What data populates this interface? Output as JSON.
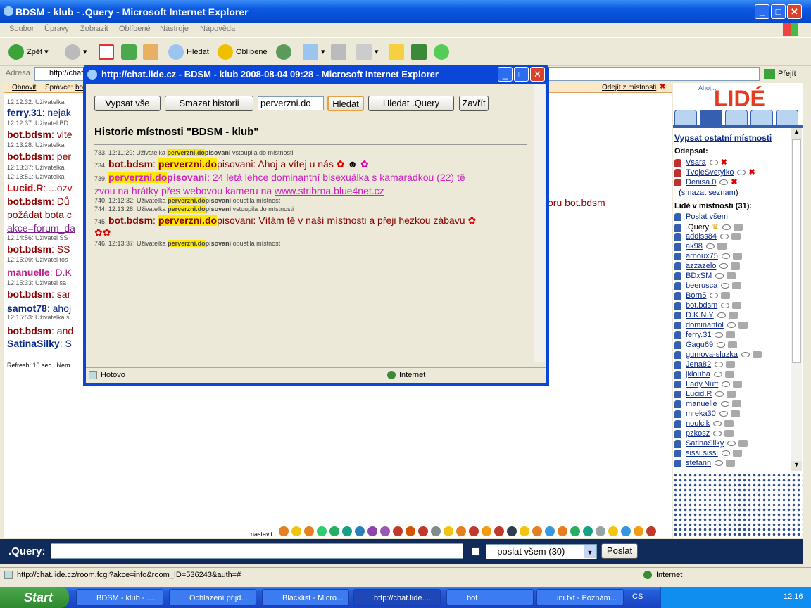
{
  "window": {
    "title": "BDSM - klub - .Query - Microsoft Internet Explorer"
  },
  "menu": [
    "Soubor",
    "Úpravy",
    "Zobrazit",
    "Oblíbené",
    "Nástroje",
    "Nápověda"
  ],
  "toolbar": {
    "back": "Zpět",
    "search": "Hledat",
    "favorites": "Oblíbené"
  },
  "address": {
    "label": "Adresa",
    "value": "http://chat",
    "go": "Přejít"
  },
  "orangebar": {
    "refresh": "Obnovit",
    "admin": "Správce:",
    "admin_name": "bo",
    "leave": "Odejít z místnosti"
  },
  "chat": [
    {
      "type": "sys",
      "text": "12:12:32: Uživatelka"
    },
    {
      "type": "msg",
      "nick": "ferry.31",
      "text": ": nejak",
      "style": "n"
    },
    {
      "type": "sys",
      "text": "12:12:37: Uživatel BD"
    },
    {
      "type": "msg",
      "nick": "bot.bdsm",
      "text": ": vite",
      "style": "b"
    },
    {
      "type": "sys",
      "text": "12:13:28: Uživatelka"
    },
    {
      "type": "msg",
      "nick": "bot.bdsm",
      "text": ": per",
      "style": "b"
    },
    {
      "type": "sys",
      "text": "12:13:37: Uživatelka"
    },
    {
      "type": "sys",
      "text": "12:13:51: Uživatelka"
    },
    {
      "type": "msg",
      "nick": "Lucid.R",
      "text": ": ...ozv",
      "style": "r"
    },
    {
      "type": "msg",
      "nick": "bot.bdsm",
      "text": ": Dů",
      "style": "b"
    },
    {
      "type": "plain",
      "text": "požádat bota c"
    },
    {
      "type": "link",
      "text": "akce=forum_da"
    },
    {
      "type": "sys",
      "text": "12:14:56: Uživatel SS"
    },
    {
      "type": "msg",
      "nick": "bot.bdsm",
      "text": ": SS",
      "style": "b"
    },
    {
      "type": "sys",
      "text": "12:15:09: Uživatel tos"
    },
    {
      "type": "msg",
      "nick": "manuelle",
      "text": ": D.K",
      "style": "m"
    },
    {
      "type": "sys",
      "text": "12:15:33: Uživatel sa"
    },
    {
      "type": "msg",
      "nick": "bot.bdsm",
      "text": ": sar",
      "style": "b"
    },
    {
      "type": "msg",
      "nick": "samot78",
      "text": ": ahoj",
      "style": "n"
    },
    {
      "type": "sys",
      "text": "12:15:53: Uživatelka s"
    },
    {
      "type": "msg",
      "nick": "bot.bdsm",
      "text": ": and",
      "style": "b"
    },
    {
      "type": "msg",
      "nick": "SatinaSilky",
      "text": ": S",
      "style": "n"
    }
  ],
  "chat_right": "oru bot.bdsm",
  "refresh_text": "Refresh: 10 sec",
  "refresh_more": "Nem",
  "popup": {
    "title": "http://chat.lide.cz - BDSM - klub 2008-08-04 09:28 - Microsoft Internet Explorer",
    "btn_all": "Vypsat vše",
    "btn_clear": "Smazat historii",
    "search_value": "perverzni.do",
    "btn_search": "Hledat",
    "btn_search_query": "Hledat .Query",
    "btn_close": "Zavřít",
    "heading": "Historie místnosti \"BDSM - klub\"",
    "l733_num": "733. 12:11:29: Uživatelka ",
    "l733_hl": "perverzni.do",
    "l733_rest": "pisovani",
    "l733_tail": " vstoupila do místnosti",
    "l734_num": "734. ",
    "l734_nick": "bot.bdsm",
    "l734_colon": ": ",
    "l734_hl": "perverzni.do",
    "l734_rest": "pisovani: Ahoj a vítej u nás",
    "l739_num": "739. ",
    "l739_hl": "perverzni.do",
    "l739_nick": "pisovani",
    "l739_text": ": 24 letá lehce dominantní bisexuálka s kamarádkou (22) tě",
    "l739_text2": "zvou na hrátky přes webovou kameru na ",
    "l739_link": "www.stribrna.blue4net.cz",
    "l740": "740. 12:12:32: Uživatelka ",
    "l740_hl": "perverzni.do",
    "l740_rest": "pisovani",
    "l740_tail": " opustila místnost",
    "l744": "744. 12:13:28: Uživatelka ",
    "l744_hl": "perverzni.do",
    "l744_rest": "pisovani",
    "l744_tail": " vstoupila do místnosti",
    "l745_num": "745. ",
    "l745_nick": "bot.bdsm",
    "l745_colon": ": ",
    "l745_hl": "perverzni.do",
    "l745_rest": "pisovani: Vítám tě v naší místnosti a přeji hezkou zábavu",
    "l746": "746. 12:13:37: Uživatelka ",
    "l746_hl": "perverzni.do",
    "l746_rest": "pisovani",
    "l746_tail": " opustila místnost",
    "status": "Hotovo",
    "zone": "Internet"
  },
  "sidebar": {
    "logo_top": "Ahoj...",
    "logo": "LIDÉ",
    "list_rooms": "Vypsat ostatní místnosti",
    "odepsat": "Odepsat:",
    "odepsat_users": [
      "Vsara",
      "TvojeSvetylko",
      "Denisa.0"
    ],
    "clear_list": "smazat seznam",
    "people_label": "Lidé v místnosti (31):",
    "send_all": "Poslat všem",
    "users": [
      ".Query",
      "addiss84",
      "ak98",
      "arnoux75",
      "azzazelo",
      "BDxSM",
      "beerusca",
      "Born5",
      "bot.bdsm",
      "D.K.N.Y",
      "dominantol",
      "ferry.31",
      "Gagu69",
      "gumova-sluzka",
      "Jena82",
      "jklouba",
      "Lady.Nutt",
      "Lucid.R",
      "manuelle",
      "mreka30",
      "noulcik",
      "pzkosz",
      "SatinaSilky",
      "sissi.sissi",
      "stefann"
    ]
  },
  "smilies_label": "nastavit",
  "input": {
    "nick": ".Query:",
    "value": "",
    "target": "-- poslat všem (30) --",
    "send": "Poslat"
  },
  "status": {
    "url": "http://chat.lide.cz/room.fcgi?akce=info&room_ID=536243&auth=#",
    "zone": "Internet"
  },
  "taskbar": {
    "start": "Start",
    "tasks": [
      "BDSM - klub - ....",
      "Ochlazení přijd...",
      "Blacklist - Micro...",
      "http://chat.lide....",
      "bot",
      "ini.txt - Poznám..."
    ],
    "lang": "CS",
    "clock": "12:16"
  }
}
